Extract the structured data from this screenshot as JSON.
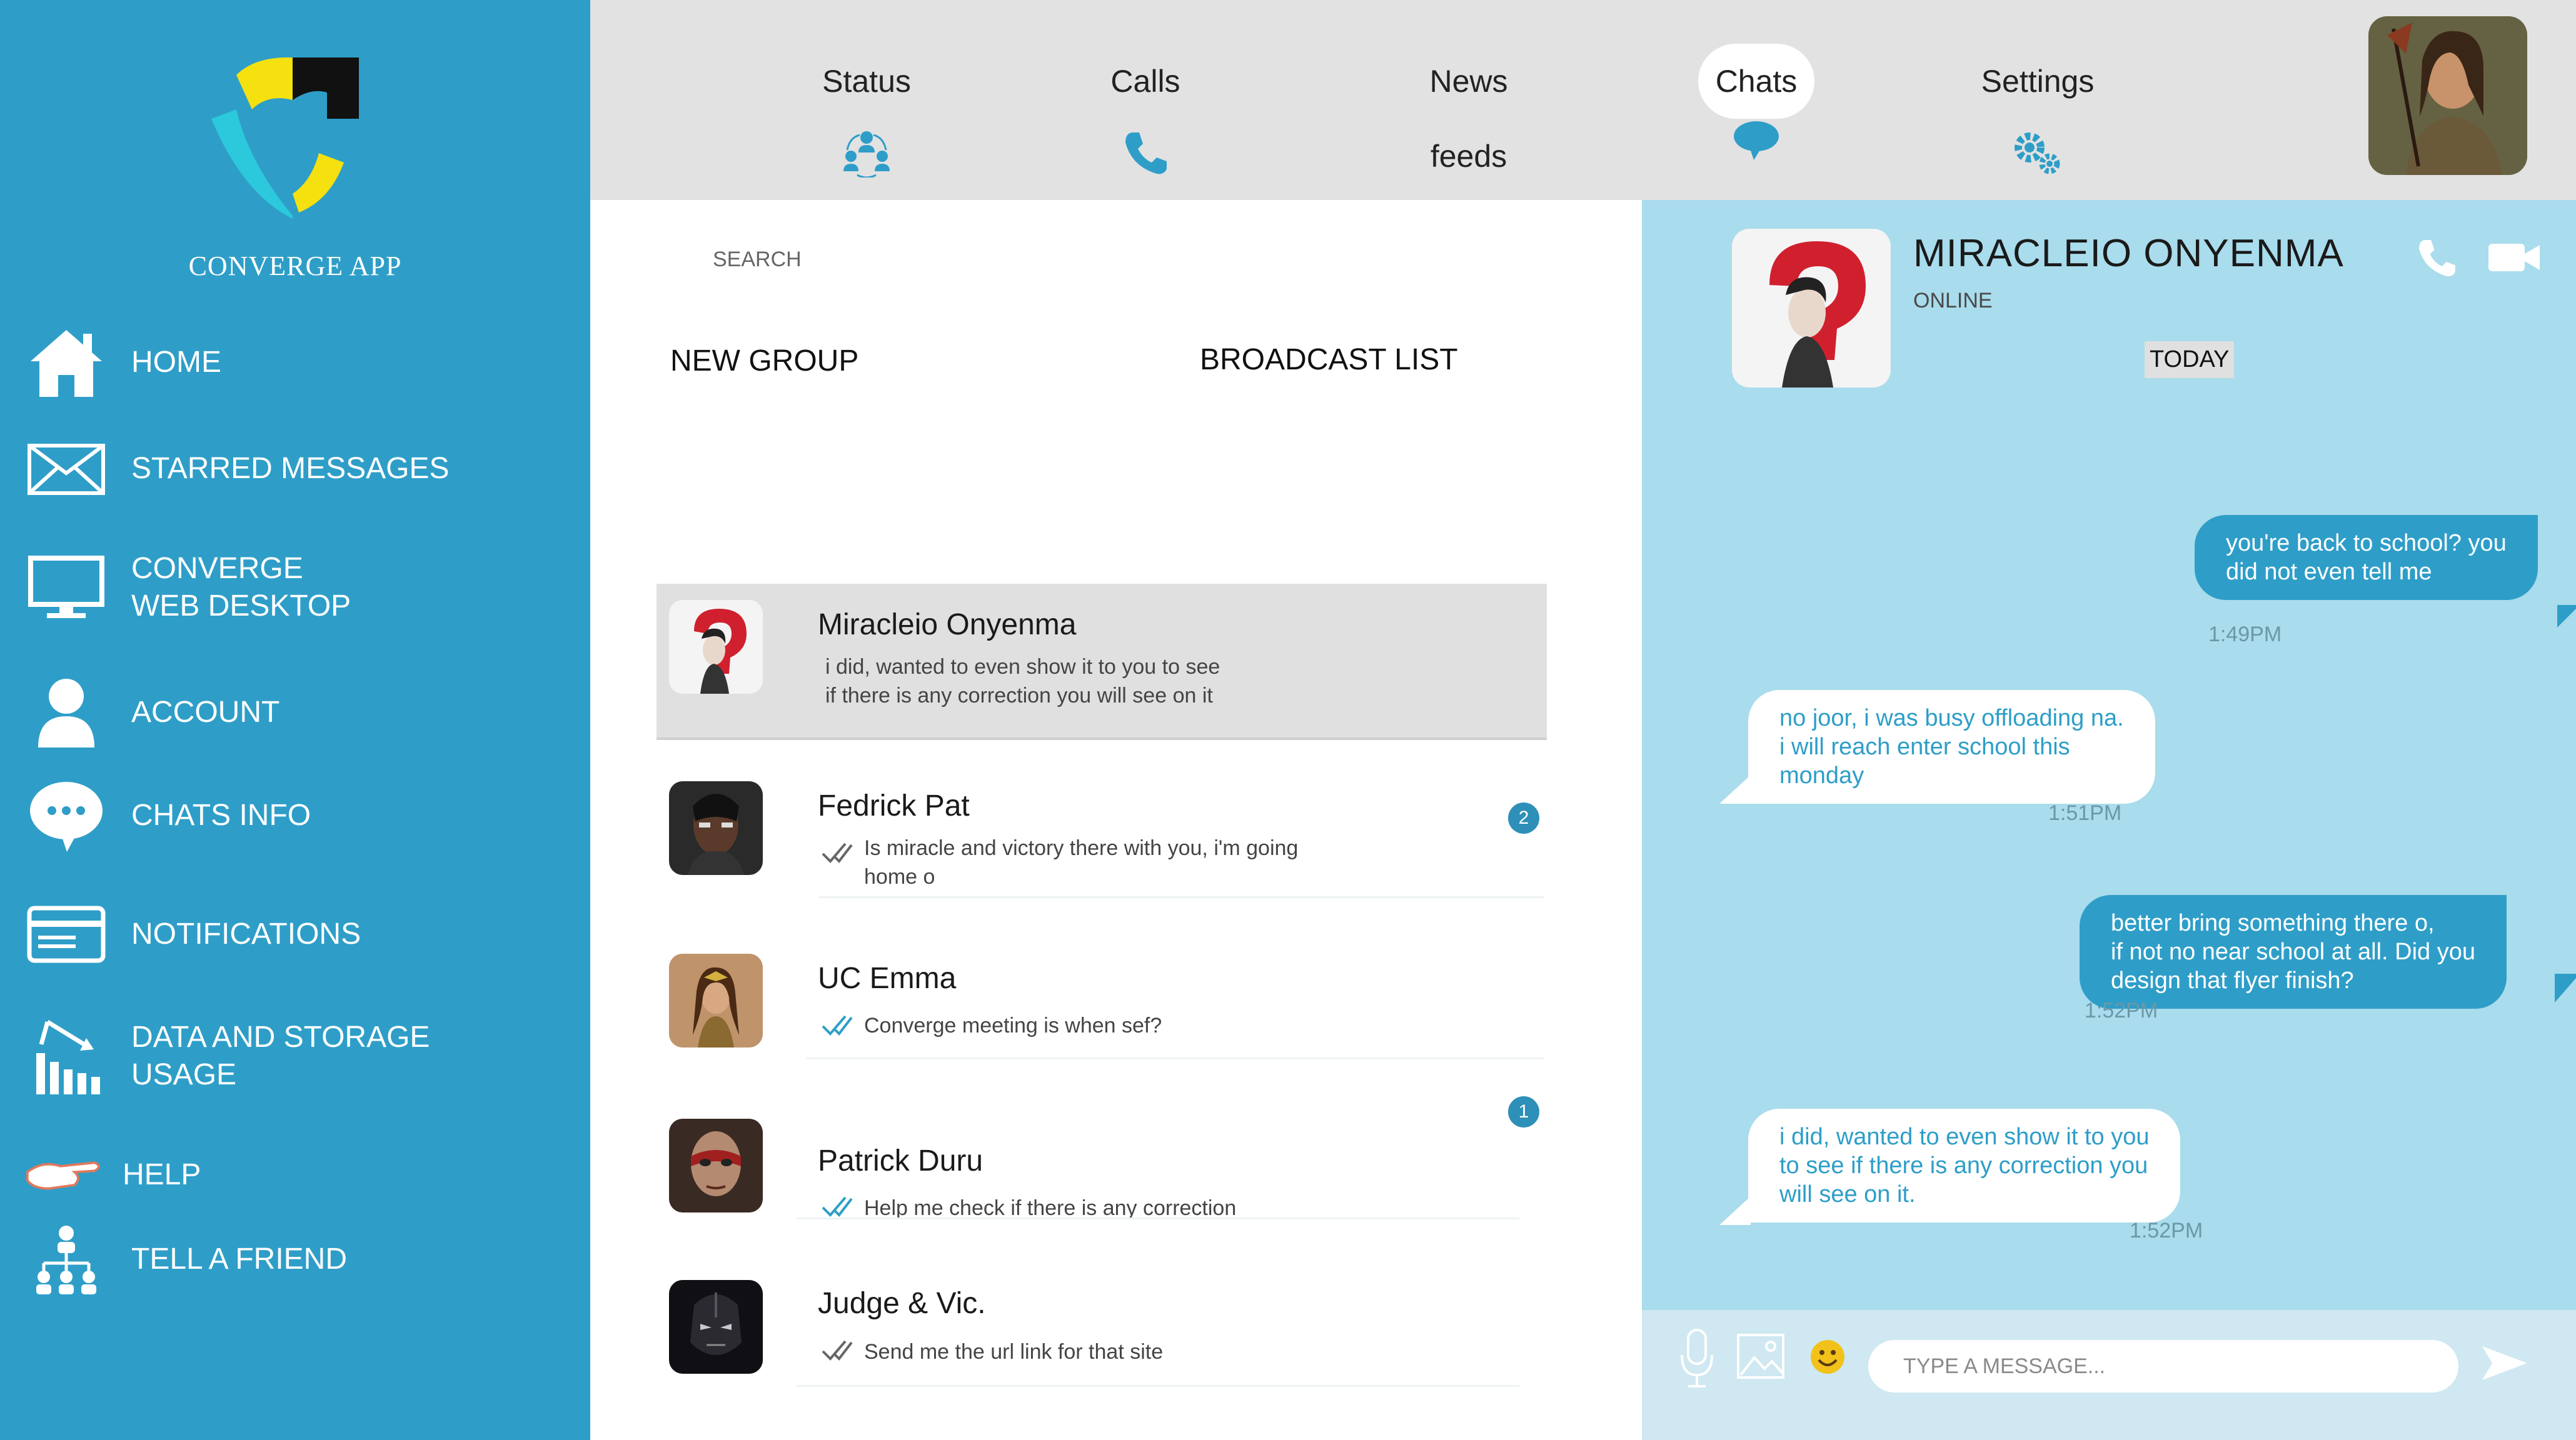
{
  "app": {
    "name": "CONVERGE APP"
  },
  "sidebar": {
    "items": [
      {
        "label": "HOME",
        "icon": "home-icon"
      },
      {
        "label": "STARRED MESSAGES",
        "icon": "envelope-icon"
      },
      {
        "label": "CONVERGE\nWEB DESKTOP",
        "icon": "monitor-icon"
      },
      {
        "label": "ACCOUNT",
        "icon": "user-icon"
      },
      {
        "label": "CHATS INFO",
        "icon": "chat-bubble-icon"
      },
      {
        "label": "NOTIFICATIONS",
        "icon": "card-icon"
      },
      {
        "label": "DATA AND STORAGE\nUSAGE",
        "icon": "bar-chart-icon"
      },
      {
        "label": "HELP",
        "icon": "hand-pointer-icon"
      },
      {
        "label": "TELL A FRIEND",
        "icon": "network-icon"
      }
    ]
  },
  "nav": {
    "tabs": [
      {
        "label": "Status",
        "icon": "people-icon"
      },
      {
        "label": "Calls",
        "icon": "phone-icon"
      },
      {
        "label": "News feeds",
        "icon": "document-icon"
      },
      {
        "label": "Chats",
        "icon": "chat-icon",
        "active": true
      },
      {
        "label": "Settings",
        "icon": "gears-icon"
      }
    ]
  },
  "list": {
    "search_label": "SEARCH",
    "new_group": "NEW GROUP",
    "broadcast": "BROADCAST LIST",
    "chats": [
      {
        "name": "Miracleio Onyenma",
        "preview": "i did, wanted to even show it to you to see\nif there is any correction you will see on it",
        "tick": "none",
        "unread": "",
        "selected": true
      },
      {
        "name": "Fedrick Pat",
        "preview": "Is miracle and victory there with you, i'm going\nhome o",
        "tick": "grey",
        "unread": "2"
      },
      {
        "name": "UC Emma",
        "preview": "Converge meeting is when sef?",
        "tick": "blue",
        "unread": ""
      },
      {
        "name": "Patrick Duru",
        "preview": "Help me check if there is any correction",
        "tick": "blue",
        "unread": "1"
      },
      {
        "name": "Judge & Vic.",
        "preview": "Send me the url link for that site",
        "tick": "grey",
        "unread": ""
      }
    ]
  },
  "conversation": {
    "contact_name": "MIRACLEIO ONYENMA",
    "status": "ONLINE",
    "date_label": "TODAY",
    "messages": [
      {
        "dir": "out",
        "text": "you're back to school? you\ndid not even tell me",
        "time": "1:49PM"
      },
      {
        "dir": "in",
        "text": "no joor, i was busy offloading na.\ni will reach enter school this\nmonday",
        "time": "1:51PM"
      },
      {
        "dir": "out",
        "text": "better bring something there o,\n if not no near school at all. Did you\ndesign that flyer finish?",
        "time": "1:52PM"
      },
      {
        "dir": "in",
        "text": "i did, wanted to even show  it to you\nto see if there is any correction you\nwill see on it.",
        "time": "1:52PM"
      }
    ],
    "input_placeholder": "TYPE A MESSAGE..."
  },
  "colors": {
    "sidebar": "#2e9ec8",
    "chat_bg": "#a9dcec",
    "accent": "#2e9ec8",
    "nav_bg": "#e2e2e2"
  }
}
